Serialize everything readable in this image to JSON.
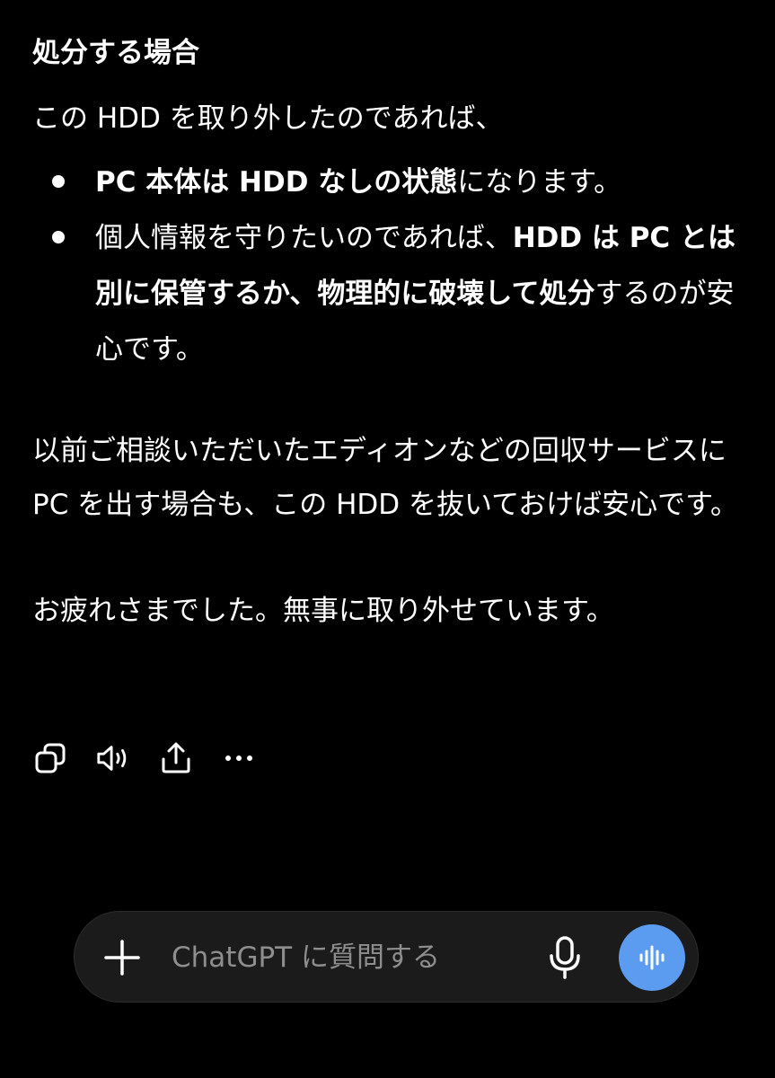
{
  "message": {
    "heading": "処分する場合",
    "intro": "この HDD を取り外したのであれば、",
    "bullets": [
      {
        "parts": [
          {
            "text": "PC 本体は HDD なしの状態",
            "bold": true
          },
          {
            "text": "になります。",
            "bold": false
          }
        ]
      },
      {
        "parts": [
          {
            "text": "個人情報を守りたいのであれば、",
            "bold": false
          },
          {
            "text": "HDD は PC とは別に保管するか、物理的に破壊して処分",
            "bold": true
          },
          {
            "text": "するのが安心です。",
            "bold": false
          }
        ]
      }
    ],
    "paragraph1": "以前ご相談いただいたエディオンなどの回収サービスに PC を出す場合も、この HDD を抜いておけば安心です。",
    "paragraph2": "お疲れさまでした。無事に取り外せています。"
  },
  "actions": [
    {
      "name": "copy-icon"
    },
    {
      "name": "read-aloud-icon"
    },
    {
      "name": "share-icon"
    },
    {
      "name": "more-icon"
    }
  ],
  "composer": {
    "placeholder": "ChatGPT に質問する",
    "value": "",
    "voice_button_color": "#5b9cf0"
  }
}
